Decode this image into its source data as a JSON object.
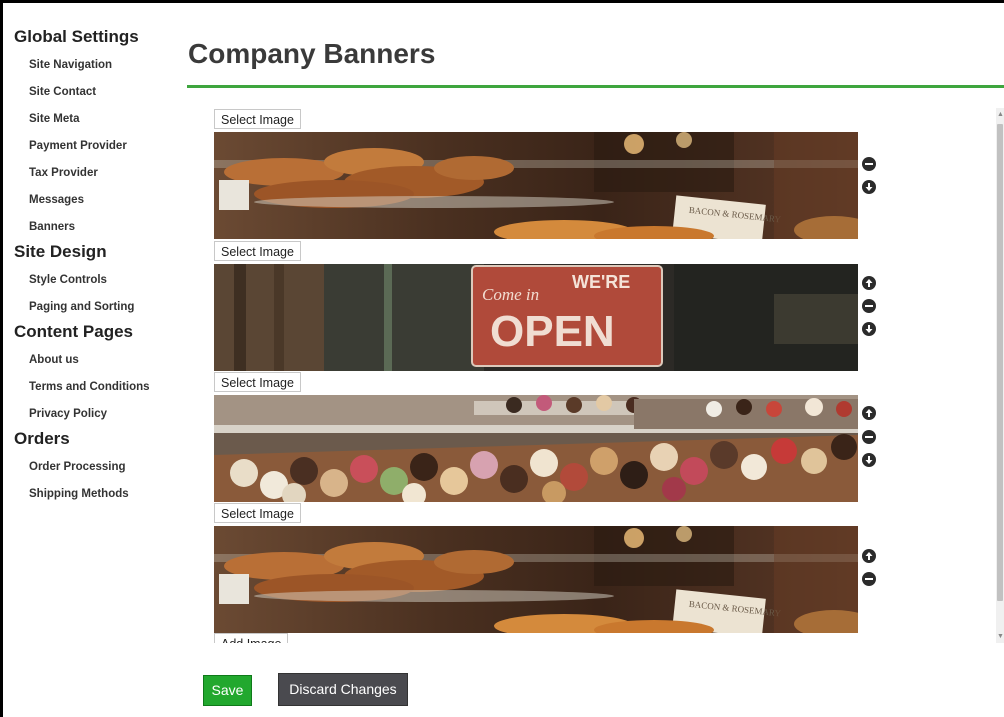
{
  "sidebar": {
    "sections": [
      {
        "title": "Global Settings",
        "items": [
          "Site Navigation",
          "Site Contact",
          "Site Meta",
          "Payment Provider",
          "Tax Provider",
          "Messages",
          "Banners"
        ]
      },
      {
        "title": "Site Design",
        "items": [
          "Style Controls",
          "Paging and Sorting"
        ]
      },
      {
        "title": "Content Pages",
        "items": [
          "About us",
          "Terms and Conditions",
          "Privacy Policy"
        ]
      },
      {
        "title": "Orders",
        "items": [
          "Order Processing",
          "Shipping Methods"
        ]
      }
    ]
  },
  "page": {
    "title": "Company Banners",
    "accent_color": "#3ea53e"
  },
  "banners": {
    "select_label": "Select Image",
    "add_label": "Add Image",
    "items": [
      {
        "image": "bakery-pastries",
        "sign_text": "BACON & ROSEMARY"
      },
      {
        "image": "open-sign",
        "sign_text_1": "Come in",
        "sign_text_2": "WE'RE",
        "sign_text_3": "OPEN"
      },
      {
        "image": "donut-display"
      },
      {
        "image": "bakery-pastries",
        "sign_text": "BACON & ROSEMARY"
      }
    ]
  },
  "actions": {
    "save_label": "Save",
    "discard_label": "Discard Changes",
    "save_color": "#22a82e",
    "discard_color": "#4a4a4f"
  }
}
